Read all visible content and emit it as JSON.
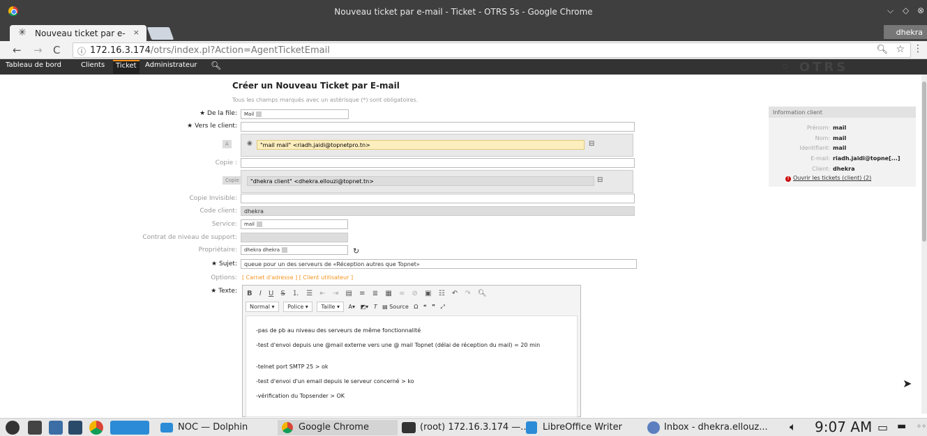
{
  "window": {
    "title": "Nouveau ticket par e-mail - Ticket - OTRS 5s - Google Chrome"
  },
  "tab": {
    "label": "Nouveau ticket par e-",
    "close": "×"
  },
  "profile": {
    "name": "dhekra"
  },
  "address": {
    "host": "172.16.3.174",
    "path": "/otrs/index.pl?Action=AgentTicketEmail"
  },
  "navbar": {
    "items": [
      "Tableau de bord",
      "Clients",
      "Ticket",
      "Administrateur"
    ]
  },
  "form": {
    "heading": "Créer un Nouveau Ticket par E-mail",
    "hint": "Tous les champs marqués avec un astérisque (*) sont obligatoires.",
    "labels": {
      "queue": "★ De la file:",
      "to": "★ Vers le client:",
      "cc": "Copie :",
      "bcc": "Copie Invisible:",
      "customer_code": "Code client:",
      "service": "Service:",
      "sla": "Contrat de niveau de support:",
      "owner": "Propriétaire:",
      "subject": "★ Sujet:",
      "options": "Options:",
      "text": "★ Texte:"
    },
    "queue_value": "Mail",
    "to_tag_button": "À",
    "to_recipient": "\"mail mail\" <riadh.jaidi@topnetpro.tn>",
    "cc_tag_button": "Copie",
    "cc_recipient": "\"dhekra client\" <dhekra.ellouzi@topnet.tn>",
    "customer_code_value": "dhekra",
    "service_value": "mail",
    "owner_value": "dhekra dhekra",
    "subject_value": "queue pour un des serveurs de «Réception autres que Topnet»",
    "options_links": "[ Carnet d'adresse ] [ Client utilisateur ]"
  },
  "editor": {
    "format_combo": "Normal",
    "font_combo": "Police",
    "size_combo": "Taille",
    "source_label": "Source",
    "lines": [
      "-pas de pb au niveau des serveurs de même fonctionnalité",
      "-test d'envoi depuis une @mail externe vers une @ mail Topnet (délai de réception du mail) = 20 min",
      "-telnet port SMTP 25 > ok",
      "-test d'envoi d'un email depuis le serveur concerné > ko",
      "-vérification du Topsender > OK"
    ]
  },
  "customer_info": {
    "title": "Information client",
    "rows": [
      {
        "key": "Prénom:",
        "value": "mail"
      },
      {
        "key": "Nom:",
        "value": "mail"
      },
      {
        "key": "Identifiant:",
        "value": "mail"
      },
      {
        "key": "E-mail:",
        "value": "riadh.jaidi@topne[...]"
      },
      {
        "key": "Client:",
        "value": "dhekra"
      }
    ],
    "open_tickets": "Ouvrir les tickets (client) (2)"
  },
  "taskbar": {
    "tasks": [
      "NOC — Dolphin",
      "Google Chrome",
      "(root) 172.16.3.174 —...",
      "LibreOffice Writer",
      "Inbox - dhekra.ellouz..."
    ],
    "clock": "9:07 AM"
  }
}
